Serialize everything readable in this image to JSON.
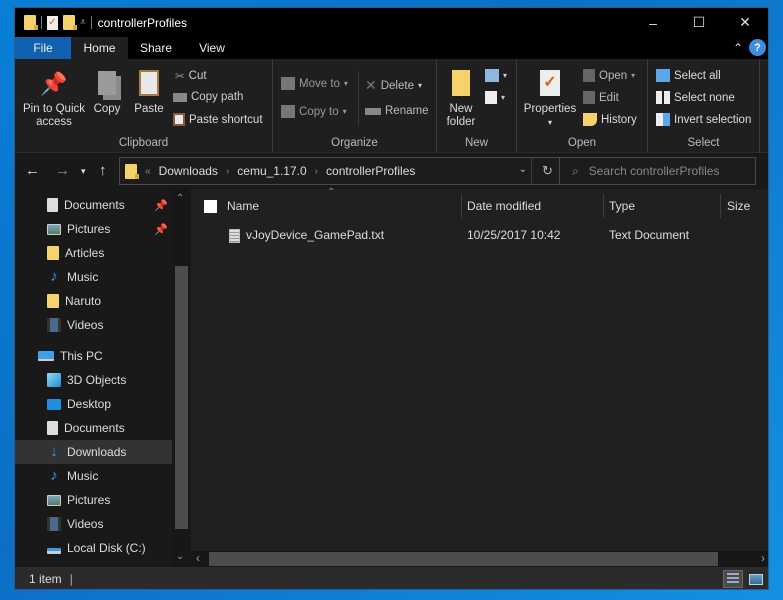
{
  "window": {
    "title": "controllerProfiles",
    "controls": {
      "minimize": "–",
      "maximize": "☐",
      "close": "✕"
    }
  },
  "ribbon_tabs": [
    {
      "label": "File",
      "active": false
    },
    {
      "label": "Home",
      "active": true
    },
    {
      "label": "Share",
      "active": false
    },
    {
      "label": "View",
      "active": false
    }
  ],
  "ribbon": {
    "clipboard": {
      "label": "Clipboard",
      "pin": "Pin to Quick access",
      "pin_line1": "Pin to Quick",
      "pin_line2": "access",
      "copy": "Copy",
      "paste": "Paste",
      "cut": "Cut",
      "copy_path": "Copy path",
      "paste_shortcut": "Paste shortcut"
    },
    "organize": {
      "label": "Organize",
      "move_to": "Move to",
      "copy_to": "Copy to",
      "delete": "Delete",
      "rename": "Rename"
    },
    "new": {
      "label": "New",
      "new_folder_line1": "New",
      "new_folder_line2": "folder"
    },
    "open": {
      "label": "Open",
      "properties": "Properties",
      "open": "Open",
      "edit": "Edit",
      "history": "History"
    },
    "select": {
      "label": "Select",
      "select_all": "Select all",
      "select_none": "Select none",
      "invert": "Invert selection"
    }
  },
  "address": {
    "overflow": "«",
    "crumbs": [
      "Downloads",
      "cemu_1.17.0",
      "controllerProfiles"
    ],
    "search_placeholder": "Search controllerProfiles"
  },
  "sidebar": {
    "quick_access": [
      {
        "label": "Documents",
        "icon": "documents-icon",
        "pinned": true
      },
      {
        "label": "Pictures",
        "icon": "pictures-icon",
        "pinned": true
      },
      {
        "label": "Articles",
        "icon": "folder-icon",
        "pinned": false
      },
      {
        "label": "Music",
        "icon": "music-icon",
        "pinned": false
      },
      {
        "label": "Naruto",
        "icon": "folder-icon",
        "pinned": false
      },
      {
        "label": "Videos",
        "icon": "videos-icon",
        "pinned": false
      }
    ],
    "this_pc": {
      "label": "This PC",
      "items": [
        {
          "label": "3D Objects",
          "icon": "3d-objects-icon"
        },
        {
          "label": "Desktop",
          "icon": "desktop-icon"
        },
        {
          "label": "Documents",
          "icon": "documents-icon"
        },
        {
          "label": "Downloads",
          "icon": "downloads-icon",
          "selected": true
        },
        {
          "label": "Music",
          "icon": "music-icon"
        },
        {
          "label": "Pictures",
          "icon": "pictures-icon"
        },
        {
          "label": "Videos",
          "icon": "videos-icon"
        },
        {
          "label": "Local Disk (C:)",
          "icon": "local-disk-icon"
        }
      ]
    }
  },
  "file_list": {
    "columns": [
      "Name",
      "Date modified",
      "Type",
      "Size"
    ],
    "rows": [
      {
        "name": "vJoyDevice_GamePad.txt",
        "date": "10/25/2017 10:42",
        "type": "Text Document",
        "size": ""
      }
    ]
  },
  "status": {
    "item_count": "1 item"
  },
  "colors": {
    "accent": "#1260b0",
    "window_bg": "#191919",
    "content_bg": "#202020"
  }
}
